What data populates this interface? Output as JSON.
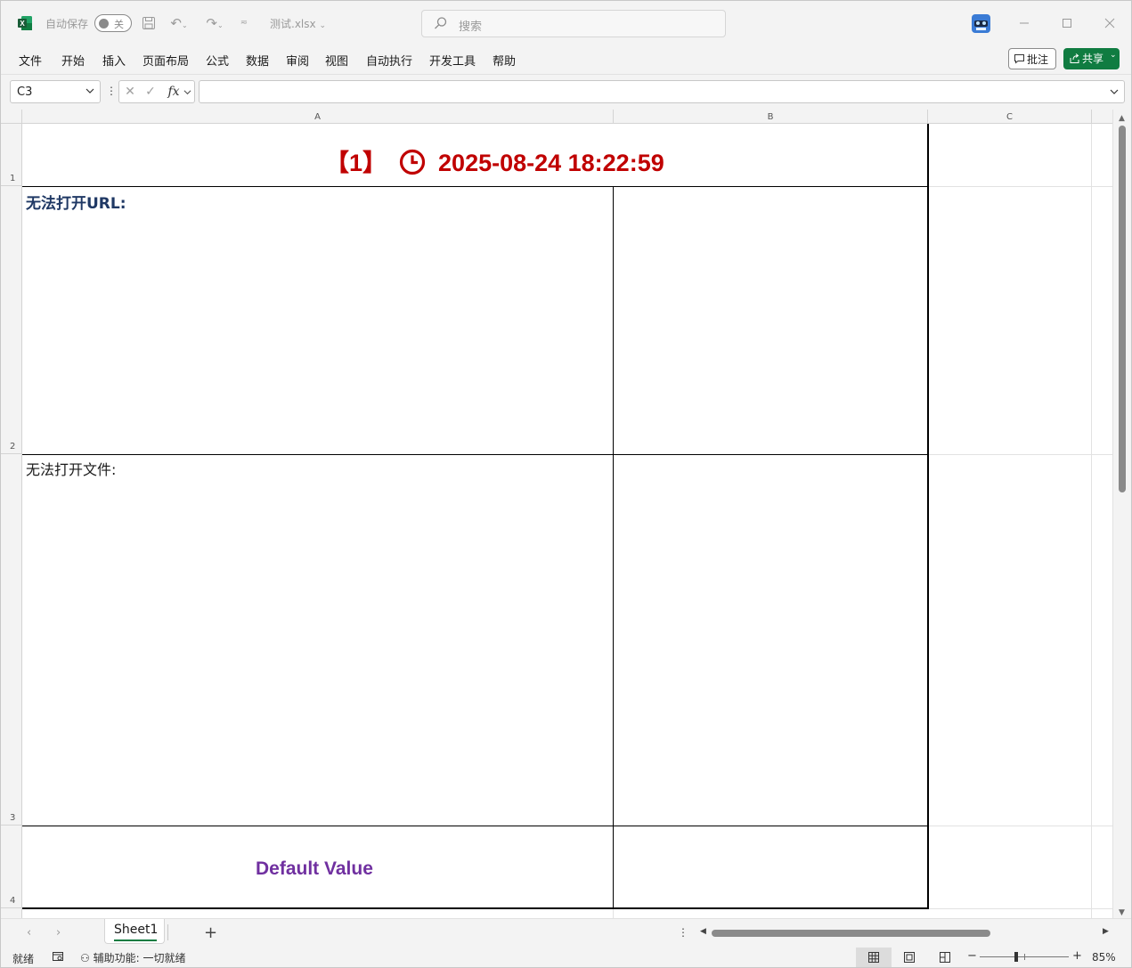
{
  "titlebar": {
    "autosave_label": "自动保存",
    "autosave_state": "关",
    "filename": "测试.xlsx",
    "search_placeholder": "搜索"
  },
  "menu": {
    "items": [
      "文件",
      "开始",
      "插入",
      "页面布局",
      "公式",
      "数据",
      "审阅",
      "视图",
      "自动执行",
      "开发工具",
      "帮助"
    ],
    "comment_label": "批注",
    "share_label": "共享"
  },
  "formula_bar": {
    "name_box": "C3",
    "fx": "fx",
    "formula": ""
  },
  "grid": {
    "columns": [
      "A",
      "B",
      "C"
    ],
    "rows": [
      "1",
      "2",
      "3",
      "4"
    ],
    "cells": {
      "A1_prefix": "【1】",
      "A1_datetime": "2025-08-24 18:22:59",
      "A2": "无法打开URL:",
      "A3": "无法打开文件:",
      "A4": "Default Value"
    }
  },
  "sheet_tabs": {
    "active": "Sheet1"
  },
  "status": {
    "ready": "就绪",
    "accessibility": "辅助功能: 一切就绪",
    "zoom": "85%"
  },
  "colors": {
    "title_red": "#c00000",
    "url_label_navy": "#1f3864",
    "default_value_purple": "#7030a0",
    "excel_green": "#107c41"
  }
}
